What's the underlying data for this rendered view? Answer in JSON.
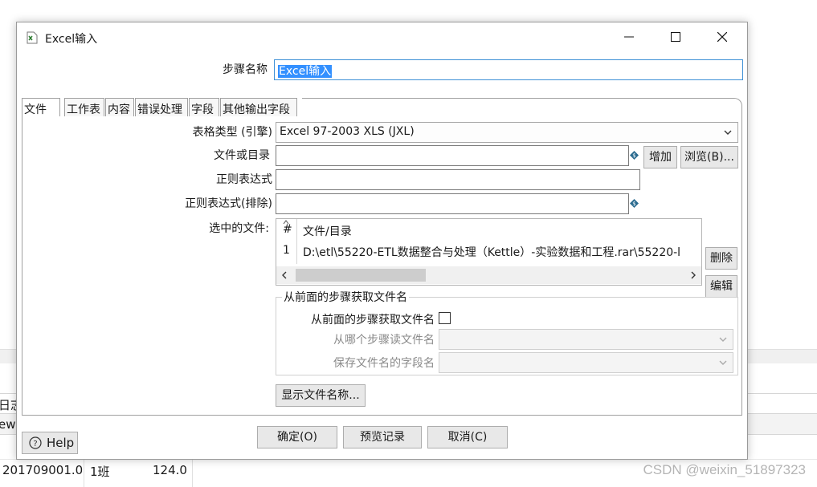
{
  "background": {
    "left_text_1": "日志",
    "left_text_2": "ew",
    "row": {
      "id": "201709001.0",
      "class": "1班",
      "score": "124.0"
    },
    "watermark": "CSDN @weixin_51897323"
  },
  "dialog": {
    "title": "Excel输入",
    "step_name_label": "步骤名称",
    "step_name_value": "Excel输入",
    "tabs": [
      "文件",
      "工作表",
      "内容",
      "错误处理",
      "字段",
      "其他输出字段"
    ],
    "file_tab": {
      "spreadsheet_type_label": "表格类型 (引擎)",
      "spreadsheet_type_value": "Excel 97-2003 XLS (JXL)",
      "file_or_dir_label": "文件或目录",
      "file_or_dir_value": "",
      "add_button": "增加",
      "browse_button": "浏览(B)...",
      "regex_label": "正则表达式",
      "regex_value": "",
      "regex_exclude_label": "正则表达式(排除)",
      "regex_exclude_value": "",
      "selected_files_label": "选中的文件:",
      "selected_files": {
        "columns": [
          "#",
          "文件/目录"
        ],
        "rows": [
          {
            "num": "1",
            "path": "D:\\etl\\55220-ETL数据整合与处理（Kettle）-实验数据和工程.rar\\55220-l"
          }
        ]
      },
      "delete_button": "删除",
      "edit_button": "编辑",
      "group_title": "从前面的步骤获取文件名",
      "accept_from_prev_label": "从前面的步骤获取文件名",
      "accept_from_prev_checked": false,
      "step_to_read_label": "从哪个步骤读文件名",
      "step_to_read_value": "",
      "field_name_label": "保存文件名的字段名",
      "field_name_value": "",
      "show_filenames_button": "显示文件名称..."
    },
    "buttons": {
      "ok": "确定(O)",
      "preview": "预览记录",
      "cancel": "取消(C)",
      "help": "Help"
    }
  }
}
